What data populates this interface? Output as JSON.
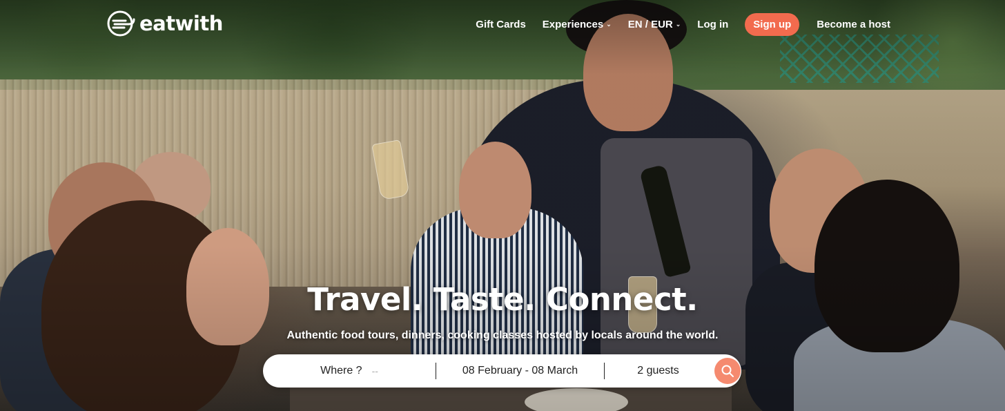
{
  "brand": {
    "name": "eatwith"
  },
  "nav": {
    "gift_cards": "Gift Cards",
    "experiences": "Experiences",
    "language_currency": "EN / EUR",
    "login": "Log in",
    "signup": "Sign up",
    "become_host": "Become a host"
  },
  "hero": {
    "headline": "Travel. Taste. Connect.",
    "subtitle": "Authentic food tours, dinners, cooking classes hosted by locals around the world."
  },
  "search": {
    "where_label": "Where ?",
    "where_placeholder": "--",
    "dates": "08 February - 08 March",
    "guests": "2 guests"
  },
  "colors": {
    "accent": "#f26b4e",
    "search_button": "#f58a6f"
  },
  "icons": {
    "search": "search-icon",
    "chevron": "chevron-down-icon",
    "logo": "eatwith-logo-icon"
  }
}
